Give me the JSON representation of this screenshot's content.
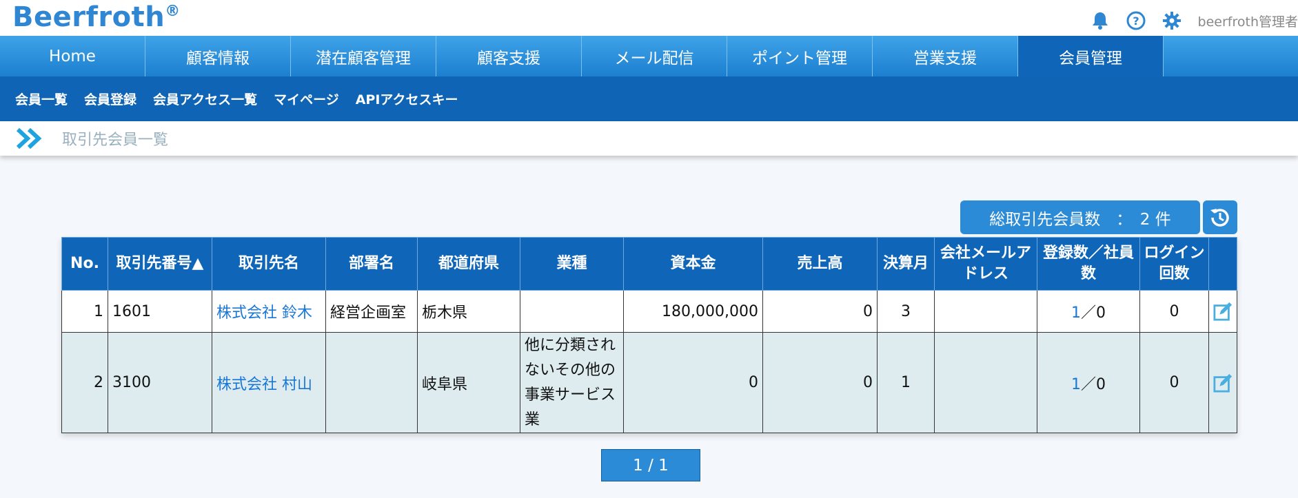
{
  "app": {
    "logo": "Beerfroth",
    "reg": "®",
    "user": "beerfroth管理者"
  },
  "nav": {
    "items": [
      "Home",
      "顧客情報",
      "潜在顧客管理",
      "顧客支援",
      "メール配信",
      "ポイント管理",
      "営業支援",
      "会員管理"
    ],
    "active": "会員管理"
  },
  "subnav": {
    "items": [
      "会員一覧",
      "会員登録",
      "会員アクセス一覧",
      "マイページ",
      "APIアクセスキー"
    ]
  },
  "breadcrumb": {
    "title": "取引先会員一覧"
  },
  "summary": {
    "label": "総取引先会員数　：　2 件"
  },
  "table": {
    "headers": [
      "No.",
      "取引先番号▲",
      "取引先名",
      "部署名",
      "都道府県",
      "業種",
      "資本金",
      "売上高",
      "決算月",
      "会社メールアドレス",
      "登録数／社員数",
      "ログイン回数",
      ""
    ],
    "rows": [
      {
        "no": "1",
        "code": "1601",
        "name": "株式会社 鈴木",
        "dept": "経営企画室",
        "pref": "栃木県",
        "industry": "",
        "capital": "180,000,000",
        "sales": "0",
        "month": "3",
        "email": "",
        "reg": "1",
        "sep": "／",
        "emp": "0",
        "logins": "0"
      },
      {
        "no": "2",
        "code": "3100",
        "name": "株式会社 村山",
        "dept": "",
        "pref": "岐阜県",
        "industry": "他に分類されないその他の事業サービス業",
        "capital": "0",
        "sales": "0",
        "month": "1",
        "email": "",
        "reg": "1",
        "sep": "／",
        "emp": "0",
        "logins": "0"
      }
    ]
  },
  "pager": {
    "label": "1 / 1"
  },
  "colors": {
    "brand": "#2f86d3",
    "nav_active": "#0f66b8",
    "link": "#1877d6"
  },
  "icons": [
    "bell-icon",
    "help-icon",
    "gear-icon",
    "chevrons-right-icon",
    "history-icon",
    "edit-icon"
  ]
}
